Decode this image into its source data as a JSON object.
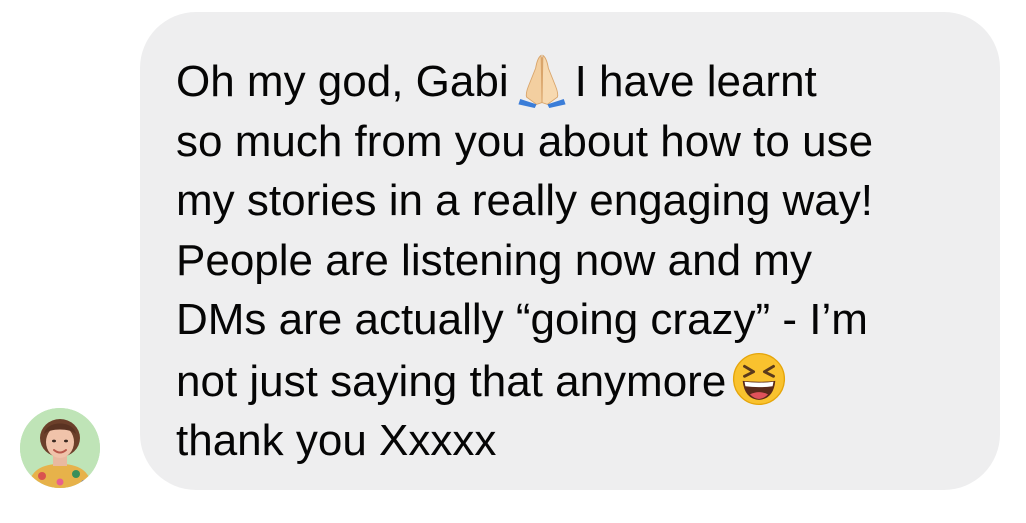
{
  "message": {
    "line1_before_emoji": "Oh my god, Gabi",
    "emoji_1": "folded-hands-icon",
    "line1_after_emoji": "I have learnt",
    "line2": "so much from you about how to use",
    "line3": "my stories in a really engaging way!",
    "line4": "People are listening now and my",
    "line5": "DMs are actually “going crazy” - I’m",
    "line6_before_emoji": "not just saying that anymore",
    "emoji_2": "grinning-squinting-face-icon",
    "line7": "thank you Xxxxx"
  },
  "sender": {
    "avatar": "avatar"
  },
  "colors": {
    "bubble": "#eeeeef",
    "text": "#050505",
    "avatar_background": "#bfe4b7"
  }
}
